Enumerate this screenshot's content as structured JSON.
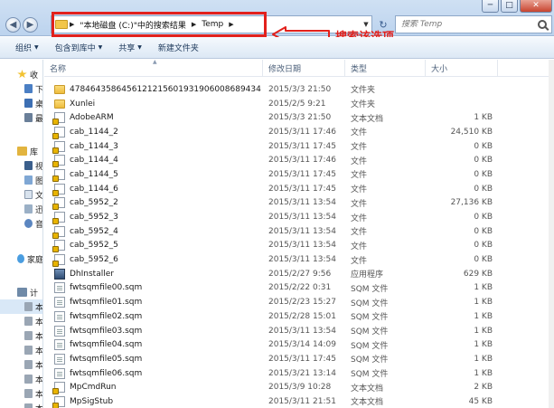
{
  "window": {
    "minimize_glyph": "─",
    "maximize_glyph": "□",
    "close_glyph": "✕"
  },
  "address": {
    "segment_search": "\"本地磁盘 (C:)\"中的搜索结果",
    "segment_folder": "Temp"
  },
  "search": {
    "placeholder": "搜索 Temp"
  },
  "annotation": {
    "text": "搜索该选项",
    "color": "#e2211c"
  },
  "toolbar": {
    "organize": "组织",
    "include_in_library": "包含到库中",
    "share": "共享",
    "new_folder": "新建文件夹"
  },
  "sidebar": {
    "favorites": "收",
    "fav_1": "下",
    "fav_2": "桌",
    "fav_3": "最",
    "libraries": "库",
    "lib_1": "视",
    "lib_2": "图",
    "lib_3": "文",
    "lib_4": "迅",
    "lib_5": "音",
    "homegroup": "家庭",
    "computer": "计",
    "drive_1": "本",
    "drive_2": "本",
    "drive_3": "本",
    "drive_4": "本",
    "drive_5": "本",
    "drive_6": "本",
    "drive_7": "本",
    "drive_8": "本"
  },
  "columns": {
    "name": "名称",
    "date": "修改日期",
    "type": "类型",
    "size": "大小"
  },
  "files": [
    {
      "name": "4784643586456121215601931906008689434",
      "date": "2015/3/3 21:50",
      "type": "文件夹",
      "size": "",
      "icon": "folder"
    },
    {
      "name": "Xunlei",
      "date": "2015/2/5 9:21",
      "type": "文件夹",
      "size": "",
      "icon": "folder"
    },
    {
      "name": "AdobeARM",
      "date": "2015/3/3 21:50",
      "type": "文本文档",
      "size": "1 KB",
      "icon": "locked-file"
    },
    {
      "name": "cab_1144_2",
      "date": "2015/3/11 17:46",
      "type": "文件",
      "size": "24,510 KB",
      "icon": "locked-file"
    },
    {
      "name": "cab_1144_3",
      "date": "2015/3/11 17:45",
      "type": "文件",
      "size": "0 KB",
      "icon": "locked-file"
    },
    {
      "name": "cab_1144_4",
      "date": "2015/3/11 17:46",
      "type": "文件",
      "size": "0 KB",
      "icon": "locked-file"
    },
    {
      "name": "cab_1144_5",
      "date": "2015/3/11 17:45",
      "type": "文件",
      "size": "0 KB",
      "icon": "locked-file"
    },
    {
      "name": "cab_1144_6",
      "date": "2015/3/11 17:45",
      "type": "文件",
      "size": "0 KB",
      "icon": "locked-file"
    },
    {
      "name": "cab_5952_2",
      "date": "2015/3/11 13:54",
      "type": "文件",
      "size": "27,136 KB",
      "icon": "locked-file"
    },
    {
      "name": "cab_5952_3",
      "date": "2015/3/11 13:54",
      "type": "文件",
      "size": "0 KB",
      "icon": "locked-file"
    },
    {
      "name": "cab_5952_4",
      "date": "2015/3/11 13:54",
      "type": "文件",
      "size": "0 KB",
      "icon": "locked-file"
    },
    {
      "name": "cab_5952_5",
      "date": "2015/3/11 13:54",
      "type": "文件",
      "size": "0 KB",
      "icon": "locked-file"
    },
    {
      "name": "cab_5952_6",
      "date": "2015/3/11 13:54",
      "type": "文件",
      "size": "0 KB",
      "icon": "locked-file"
    },
    {
      "name": "DhInstaller",
      "date": "2015/2/27 9:56",
      "type": "应用程序",
      "size": "629 KB",
      "icon": "app"
    },
    {
      "name": "fwtsqmfile00.sqm",
      "date": "2015/2/22 0:31",
      "type": "SQM 文件",
      "size": "1 KB",
      "icon": "doc"
    },
    {
      "name": "fwtsqmfile01.sqm",
      "date": "2015/2/23 15:27",
      "type": "SQM 文件",
      "size": "1 KB",
      "icon": "doc"
    },
    {
      "name": "fwtsqmfile02.sqm",
      "date": "2015/2/28 15:01",
      "type": "SQM 文件",
      "size": "1 KB",
      "icon": "doc"
    },
    {
      "name": "fwtsqmfile03.sqm",
      "date": "2015/3/11 13:54",
      "type": "SQM 文件",
      "size": "1 KB",
      "icon": "doc"
    },
    {
      "name": "fwtsqmfile04.sqm",
      "date": "2015/3/14 14:09",
      "type": "SQM 文件",
      "size": "1 KB",
      "icon": "doc"
    },
    {
      "name": "fwtsqmfile05.sqm",
      "date": "2015/3/11 17:45",
      "type": "SQM 文件",
      "size": "1 KB",
      "icon": "doc"
    },
    {
      "name": "fwtsqmfile06.sqm",
      "date": "2015/3/21 13:14",
      "type": "SQM 文件",
      "size": "1 KB",
      "icon": "doc"
    },
    {
      "name": "MpCmdRun",
      "date": "2015/3/9 10:28",
      "type": "文本文档",
      "size": "2 KB",
      "icon": "locked-file"
    },
    {
      "name": "MpSigStub",
      "date": "2015/3/11 21:51",
      "type": "文本文档",
      "size": "45 KB",
      "icon": "locked-file"
    }
  ]
}
